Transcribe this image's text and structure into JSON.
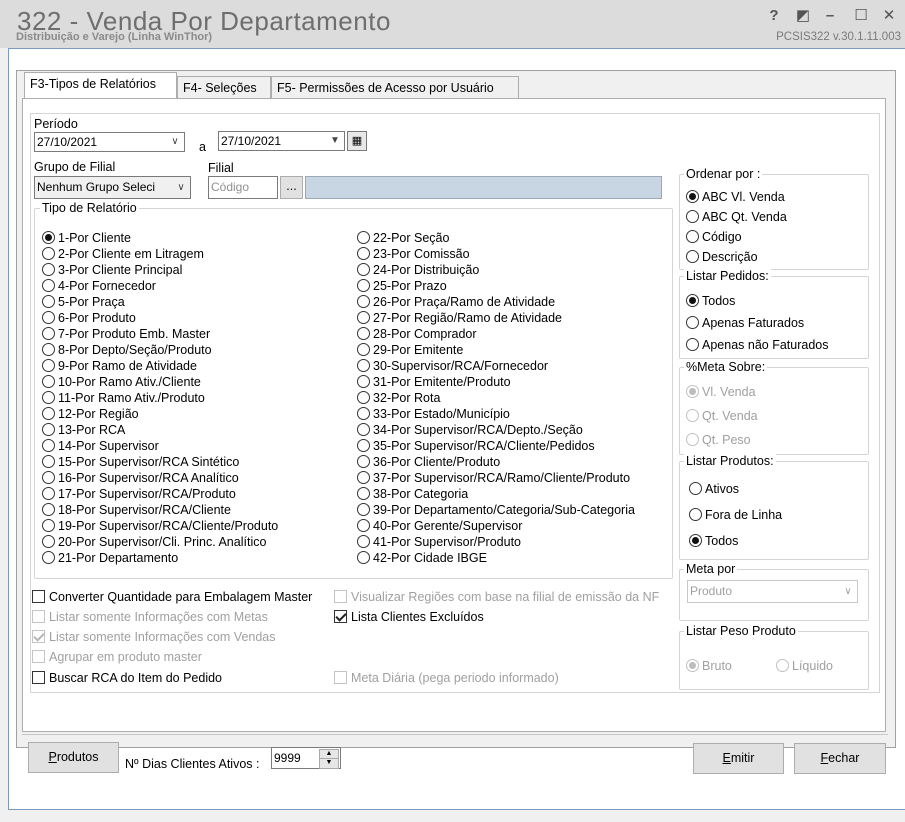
{
  "window": {
    "title": "322 - Venda Por Departamento",
    "subtitle": "Distribuição e Varejo (Linha WinThor)",
    "version": "PCSIS322  v.30.1.11.003",
    "help": "?",
    "restore": "◩",
    "minimize": "–",
    "maximize": "☐",
    "close": "✕"
  },
  "tabs": [
    {
      "label": "F3-Tipos de Relatórios",
      "active": true
    },
    {
      "label": "F4- Seleções",
      "active": false
    },
    {
      "label": "F5- Permissões de Acesso por Usuário",
      "active": false
    }
  ],
  "periodo": {
    "label": "Período",
    "start": "27/10/2021",
    "sep": "a",
    "end": "27/10/2021"
  },
  "grupo_filial": {
    "label": "Grupo de Filial",
    "value": "Nenhum Grupo Seleci"
  },
  "filial": {
    "label": "Filial",
    "placeholder": "Código",
    "lookup": "...",
    "name": ""
  },
  "tipo_relatorio": {
    "label": "Tipo de Relatório",
    "col1": [
      "1-Por Cliente",
      "2-Por Cliente em Litragem",
      "3-Por Cliente Principal",
      "4-Por Fornecedor",
      "5-Por Praça",
      "6-Por Produto",
      "7-Por Produto Emb. Master",
      "8-Por Depto/Seção/Produto",
      "9-Por Ramo de Atividade",
      "10-Por Ramo Ativ./Cliente",
      "11-Por Ramo Ativ./Produto",
      "12-Por Região",
      "13-Por RCA",
      "14-Por Supervisor",
      "15-Por Supervisor/RCA Sintético",
      "16-Por Supervisor/RCA Analítico",
      "17-Por Supervisor/RCA/Produto",
      "18-Por Supervisor/RCA/Cliente",
      "19-Por Supervisor/RCA/Cliente/Produto",
      "20-Por Supervisor/Cli. Princ. Analítico",
      "21-Por Departamento"
    ],
    "col2": [
      "22-Por Seção",
      "23-Por Comissão",
      "24-Por Distribuição",
      "25-Por Prazo",
      "26-Por Praça/Ramo de Atividade",
      "27-Por Região/Ramo de Atividade",
      "28-Por Comprador",
      "29-Por Emitente",
      "30-Supervisor/RCA/Fornecedor",
      "31-Por Emitente/Produto",
      "32-Por Rota",
      "33-Por Estado/Município",
      "34-Por Supervisor/RCA/Depto./Seção",
      "35-Por Supervisor/RCA/Cliente/Pedidos",
      "36-Por Cliente/Produto",
      "37-Por Supervisor/RCA/Ramo/Cliente/Produto",
      "38-Por Categoria",
      "39-Por Departamento/Categoria/Sub-Categoria",
      "40-Por Gerente/Supervisor",
      "41-Por Supervisor/Produto",
      "42-Por Cidade IBGE"
    ],
    "selected": "1-Por Cliente"
  },
  "options": {
    "converter": "Converter Quantidade para Embalagem Master",
    "somente_metas": "Listar somente Informações com Metas",
    "somente_vendas": "Listar somente Informações com Vendas",
    "agrupar": "Agrupar em produto master",
    "buscar_rca": "Buscar RCA do Item do Pedido",
    "visualizar_regioes": "Visualizar Regiões com base na filial de emissão da NF",
    "lista_excluidos": "Lista Clientes Excluídos",
    "meta_diaria": "Meta Diária (pega periodo informado)"
  },
  "ordenar_por": {
    "label": "Ordenar por :",
    "items": [
      "ABC Vl. Venda",
      "ABC Qt. Venda",
      "Código",
      "Descrição"
    ],
    "selected": "ABC Vl. Venda"
  },
  "listar_pedidos": {
    "label": "Listar Pedidos:",
    "items": [
      "Todos",
      "Apenas Faturados",
      "Apenas não Faturados"
    ],
    "selected": "Todos"
  },
  "meta_sobre": {
    "label": "%Meta Sobre:",
    "items": [
      "Vl. Venda",
      "Qt. Venda",
      "Qt. Peso"
    ],
    "selected": "Vl. Venda"
  },
  "listar_produtos": {
    "label": "Listar Produtos:",
    "items": [
      "Ativos",
      "Fora de Linha",
      "Todos"
    ],
    "selected": "Todos"
  },
  "meta_por": {
    "label": "Meta por",
    "value": "Produto"
  },
  "listar_peso": {
    "label": "Listar Peso Produto",
    "items": [
      "Bruto",
      "Líquido"
    ],
    "selected": "Bruto"
  },
  "footer": {
    "produtos_btn": "Produtos",
    "dias_label": "Nº Dias Clientes Ativos :",
    "dias_value": "9999",
    "emitir_btn": "Emitir",
    "fechar_btn": "Fechar"
  }
}
